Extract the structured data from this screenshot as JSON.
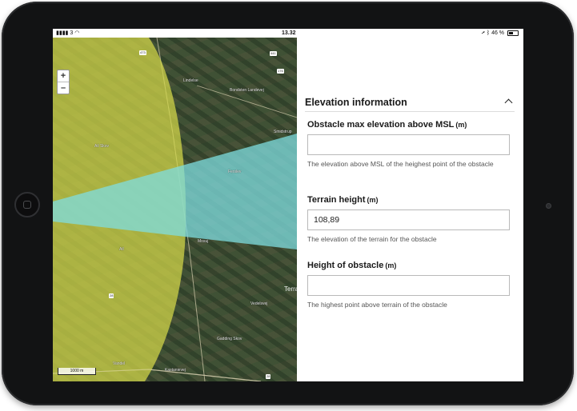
{
  "status": {
    "signal": "3",
    "time": "13.32",
    "battery": "46 %"
  },
  "map": {
    "zoom_in": "+",
    "zoom_out": "–",
    "scale": "1000 m",
    "edge_label": "Terra",
    "places": [
      "Lindelse",
      "Bondsten Landevej",
      "Smidstrup",
      "Ferslev",
      "Ail Skov",
      "Mosuj",
      "Ail",
      "Gadding Skov",
      "Vandel",
      "Kastanievej",
      "Vedelsvej"
    ],
    "roads": [
      "473",
      "441",
      "176",
      "28",
      "28"
    ]
  },
  "panel": {
    "section_title": "Elevation information",
    "fields": [
      {
        "label": "Obstacle max elevation above MSL",
        "unit": "(m)",
        "value": "",
        "help": "The elevation above MSL of the heighest point of the obstacle"
      },
      {
        "label": "Terrain height",
        "unit": "(m)",
        "value": "108,89",
        "help": "The elevation of the terrain for the obstacle"
      },
      {
        "label": "Height of obstacle",
        "unit": "(m)",
        "value": "",
        "help": "The highest point above terrain of the obstacle"
      }
    ]
  },
  "colors": {
    "buffer_yellow": "#d6d94a",
    "sector_cyan": "#7fdde0"
  }
}
